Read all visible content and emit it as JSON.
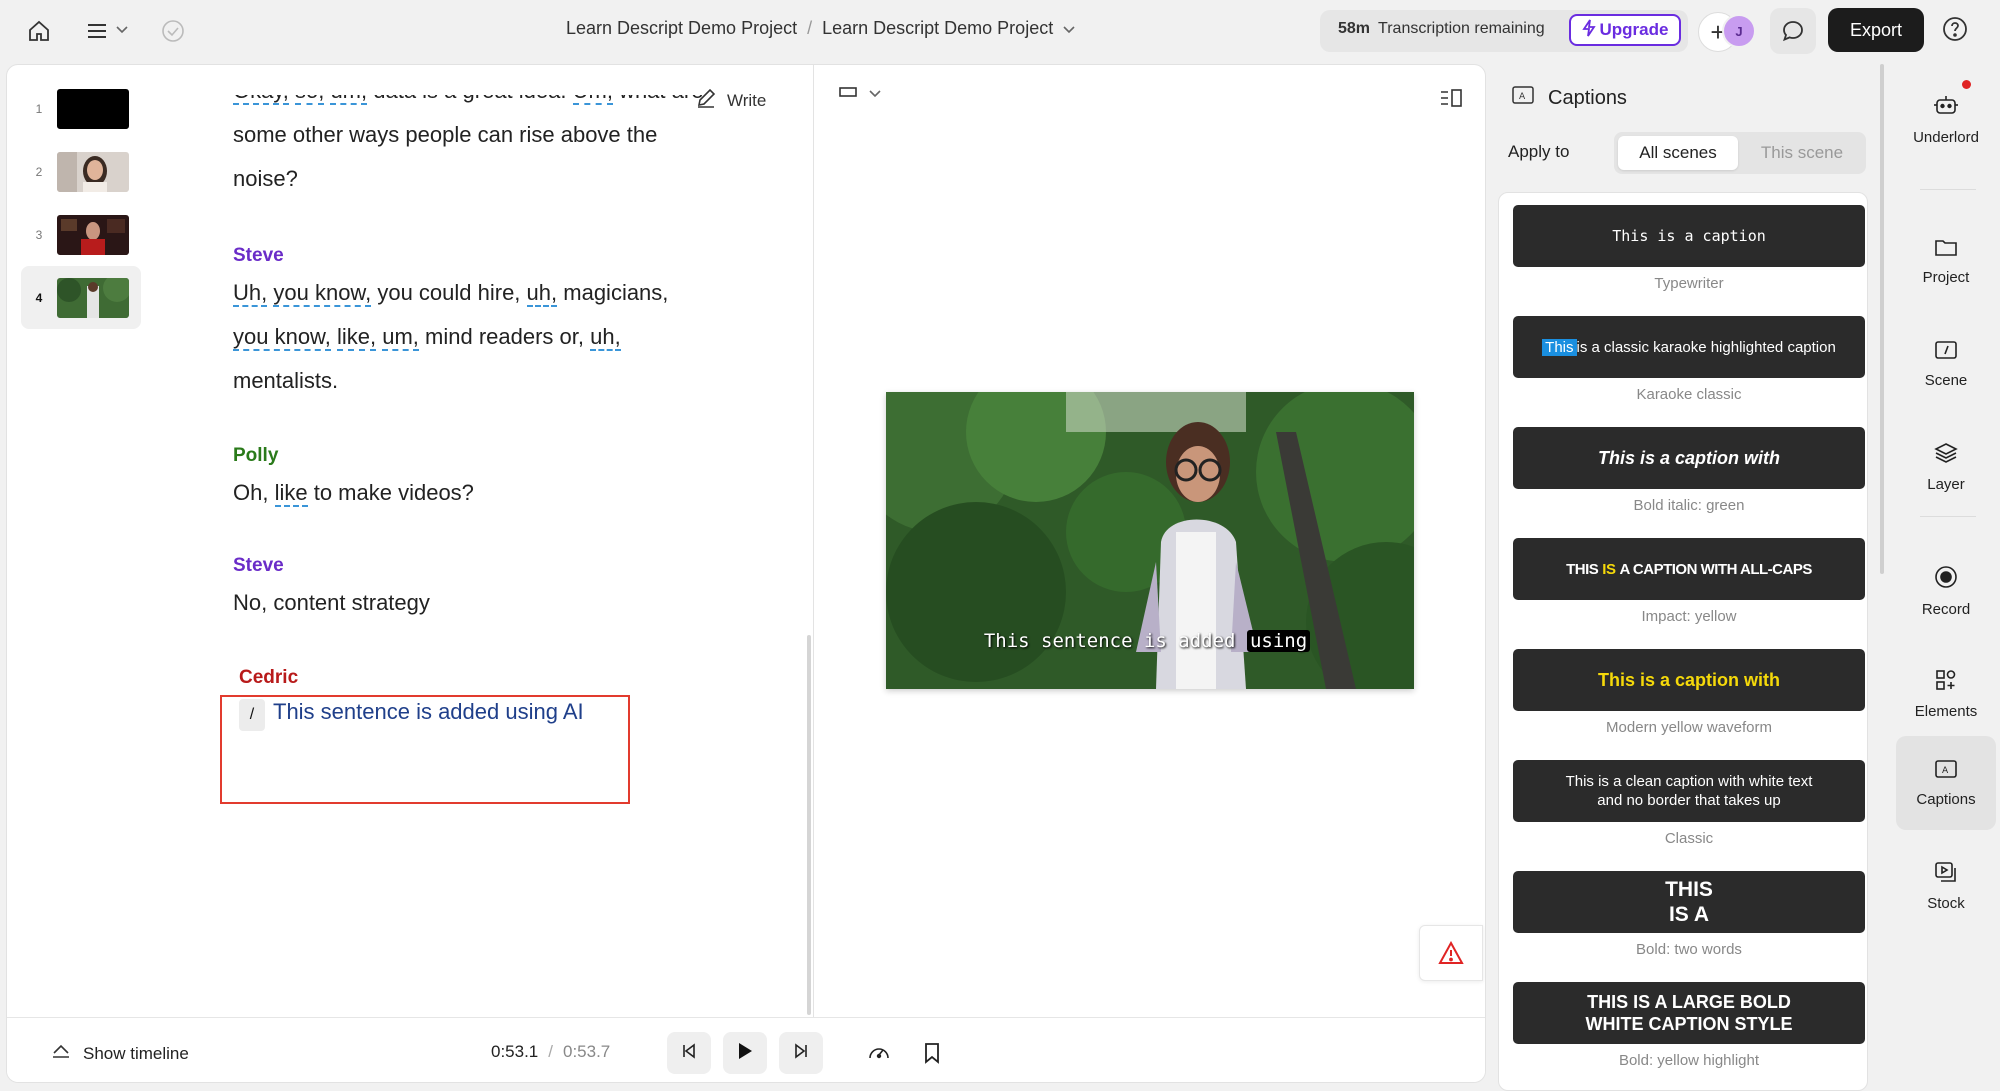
{
  "topbar": {
    "breadcrumb": [
      "Learn Descript Demo Project",
      "Learn Descript Demo Project"
    ],
    "breadcrumb_separator": "/",
    "transcription_amount": "58m",
    "transcription_label": "Transcription remaining",
    "upgrade_label": "Upgrade",
    "avatar_initial": "J",
    "export_label": "Export",
    "icons": [
      "home-icon",
      "menu-icon",
      "chevron-down-icon",
      "check-circle-icon",
      "plus-icon",
      "comment-icon",
      "help-icon"
    ]
  },
  "scenes": [
    {
      "number": "1",
      "thumb": "black"
    },
    {
      "number": "2",
      "thumb": "woman-speaking"
    },
    {
      "number": "3",
      "thumb": "man-red-shirt"
    },
    {
      "number": "4",
      "thumb": "girl-outdoors",
      "active": true
    }
  ],
  "editor": {
    "write_label": "Write",
    "paragraphs": [
      {
        "speaker": "",
        "lines": [
          [
            "Okay, so, um, data is a great idea. Um, what are"
          ],
          [
            "some other ways people can rise above the"
          ],
          [
            "noise?"
          ]
        ]
      },
      {
        "speaker": "Steve",
        "speaker_color": "#6a2cc8"
      },
      {
        "speaker": "Polly",
        "speaker_color": "#2a7a1a",
        "text": "Oh, like to make videos?"
      },
      {
        "speaker": "Steve",
        "speaker_color": "#6a2cc8",
        "text": "No, content strategy"
      },
      {
        "speaker": "Cedric",
        "speaker_color": "#b81a1a",
        "slash": "/",
        "text": "This sentence is added using AI"
      }
    ],
    "steve_line1": {
      "w1": "Uh,",
      "w2": "you know,",
      "rest": " you could hire,",
      "w3": "uh,",
      "end": " magicians,"
    },
    "steve_line2": {
      "w1": "you know,",
      "w2": "like,",
      "w3": "um,",
      "mid": " mind readers or,",
      "w4": "uh,"
    },
    "steve_line3": "mentalists.",
    "polly_words": {
      "a": "Oh,",
      "b": "like",
      "c": " to make videos?"
    },
    "top_line1": {
      "a": "Okay,",
      "b": "so,",
      "c": "um,",
      "d": " data is a great idea.",
      "e": "Um,",
      "f": " what are"
    }
  },
  "video": {
    "caption_plain": "This sentence is added",
    "caption_highlight": "using"
  },
  "playback": {
    "show_timeline_label": "Show timeline",
    "current_time": "0:53.1",
    "separator": "/",
    "total_time": "0:53.7"
  },
  "captions_panel": {
    "title": "Captions",
    "apply_to_label": "Apply to",
    "apply_options": [
      "All scenes",
      "This scene"
    ],
    "apply_selected": "All scenes",
    "presets": [
      {
        "preview": "This is a caption",
        "name": "Typewriter"
      },
      {
        "preview_hl": "This",
        "preview": " is a classic karaoke highlighted caption",
        "name": "Karaoke classic"
      },
      {
        "preview": "This is a caption with",
        "name": "Bold italic: green"
      },
      {
        "preview_a": "THIS ",
        "preview_hl": "IS",
        "preview_b": " A CAPTION WITH ALL-CAPS",
        "name": "Impact: yellow"
      },
      {
        "preview": "This is a caption with",
        "name": "Modern yellow waveform",
        "accent": "#f5d90a"
      },
      {
        "preview": "This is a clean caption with white text and no border that takes up",
        "name": "Classic"
      },
      {
        "preview": "THIS IS A",
        "name": "Bold: two words"
      },
      {
        "preview": "THIS IS A LARGE BOLD WHITE CAPTION STYLE",
        "name": "Bold: yellow highlight"
      }
    ]
  },
  "rail": [
    {
      "label": "Underlord",
      "icon": "robot-icon"
    },
    {
      "label": "Project",
      "icon": "folder-icon"
    },
    {
      "label": "Scene",
      "icon": "scene-icon"
    },
    {
      "label": "Layer",
      "icon": "layers-icon"
    },
    {
      "label": "Record",
      "icon": "record-icon"
    },
    {
      "label": "Elements",
      "icon": "elements-icon"
    },
    {
      "label": "Captions",
      "icon": "captions-icon",
      "active": true
    },
    {
      "label": "Stock",
      "icon": "stock-icon"
    }
  ],
  "colors": {
    "accent": "#6a2ce0",
    "highlight_box": "#e23b2e",
    "filler_underline": "#3a95d8",
    "ai_text": "#1f3f8a"
  }
}
